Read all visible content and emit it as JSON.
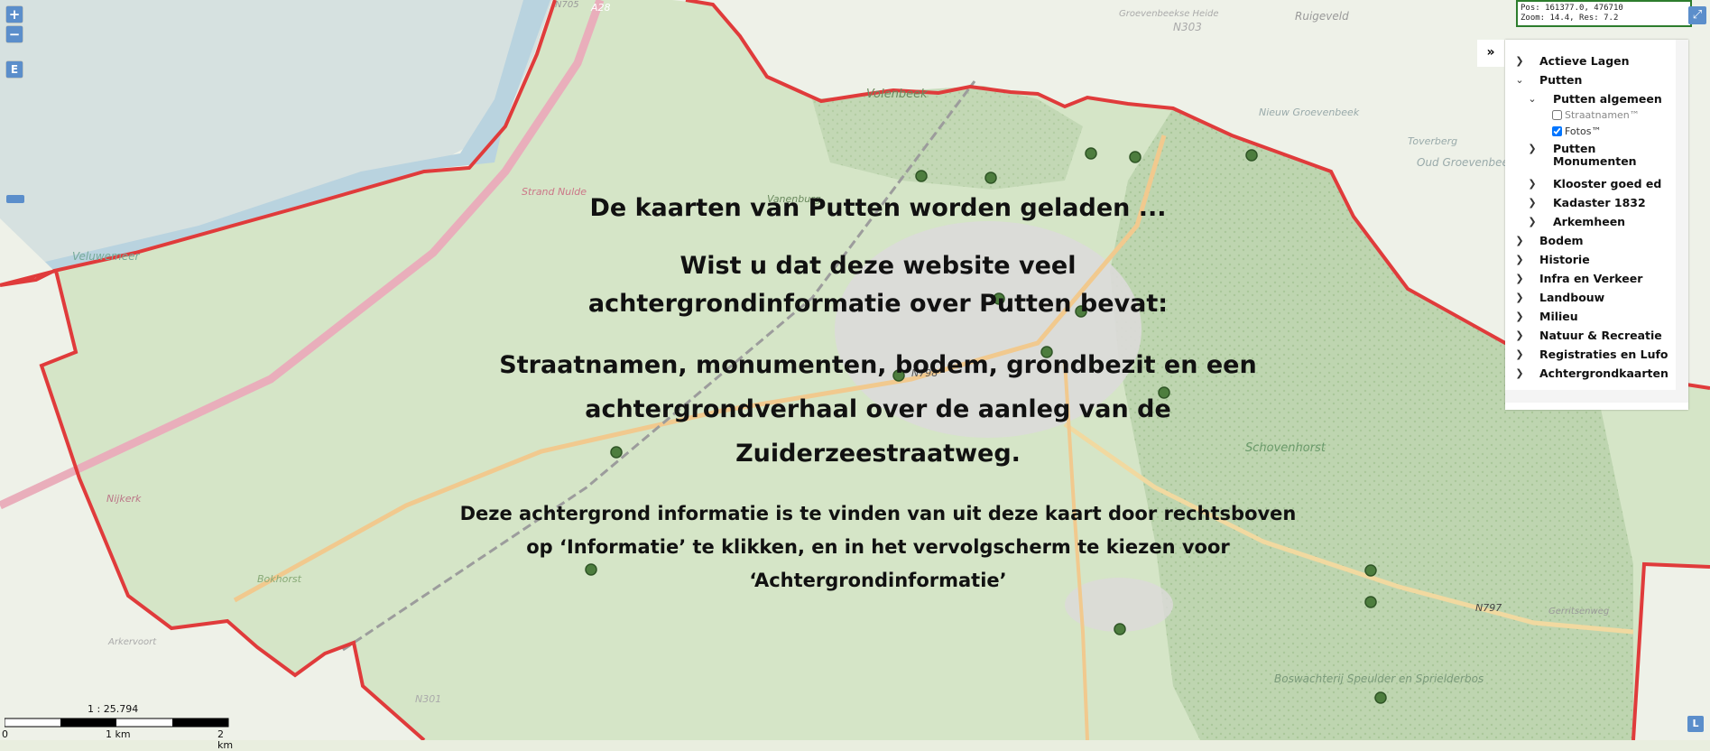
{
  "map": {
    "position_readout": "Pos: 161377.0, 476710",
    "zoom_readout": "Zoom: 14.4, Res: 7.2",
    "controls": {
      "zoom_in": "+",
      "zoom_out": "−",
      "e_button": "E",
      "collapse": "»",
      "expand": "⤢",
      "l_button": "L"
    },
    "scale": {
      "ratio": "1 : 25.794",
      "ticks": [
        "0",
        "1 km",
        "2 km"
      ]
    },
    "place_labels": [
      "A28",
      "N705",
      "N303",
      "Volenbeek",
      "Ruigeveld",
      "Nieuw Groevenbeek",
      "Toverberg",
      "Oud Groevenbeek",
      "Groevenbeekse Heide",
      "Strand Nulde",
      "Veluwemeer",
      "Vanenburg",
      "Sprielderbos",
      "Schovenhorst",
      "Nijkerk",
      "Bokhorst",
      "Arkervoort",
      "N798",
      "N301",
      "N797",
      "Boswachterij Speulder en Sprielderbos",
      "Gerritsenweg"
    ]
  },
  "overlay": {
    "title": "De kaarten van Putten worden geladen ...",
    "line1": "Wist u dat deze website veel",
    "line2": "achtergrondinformatie over Putten bevat:",
    "line3": "Straatnamen, monumenten, bodem, grondbezit en een",
    "line4": "achtergrondverhaal over de aanleg van de Zuiderzeestraatweg.",
    "para1": "Deze achtergrond informatie is te vinden van uit deze kaart door rechtsboven",
    "para2": "op ‘Informatie’ te klikken, en in het vervolgscherm te kiezen voor",
    "para3": "‘Achtergrondinformatie’"
  },
  "layers": {
    "actieve_lagen": "Actieve Lagen",
    "putten": "Putten",
    "putten_algemeen": "Putten algemeen",
    "straatnamen": "Straatnamen™",
    "fotos": "Fotos™",
    "putten_monumenten_1": "Putten",
    "putten_monumenten_2": "Monumenten",
    "klooster": "Klooster goed ed",
    "kadaster": "Kadaster 1832",
    "arkemheen": "Arkemheen",
    "bodem": "Bodem",
    "historie": "Historie",
    "infra": "Infra en Verkeer",
    "landbouw": "Landbouw",
    "milieu": "Milieu",
    "natuur": "Natuur & Recreatie",
    "registraties": "Registraties en Lufo",
    "achtergrondkaarten": "Achtergrondkaarten"
  }
}
